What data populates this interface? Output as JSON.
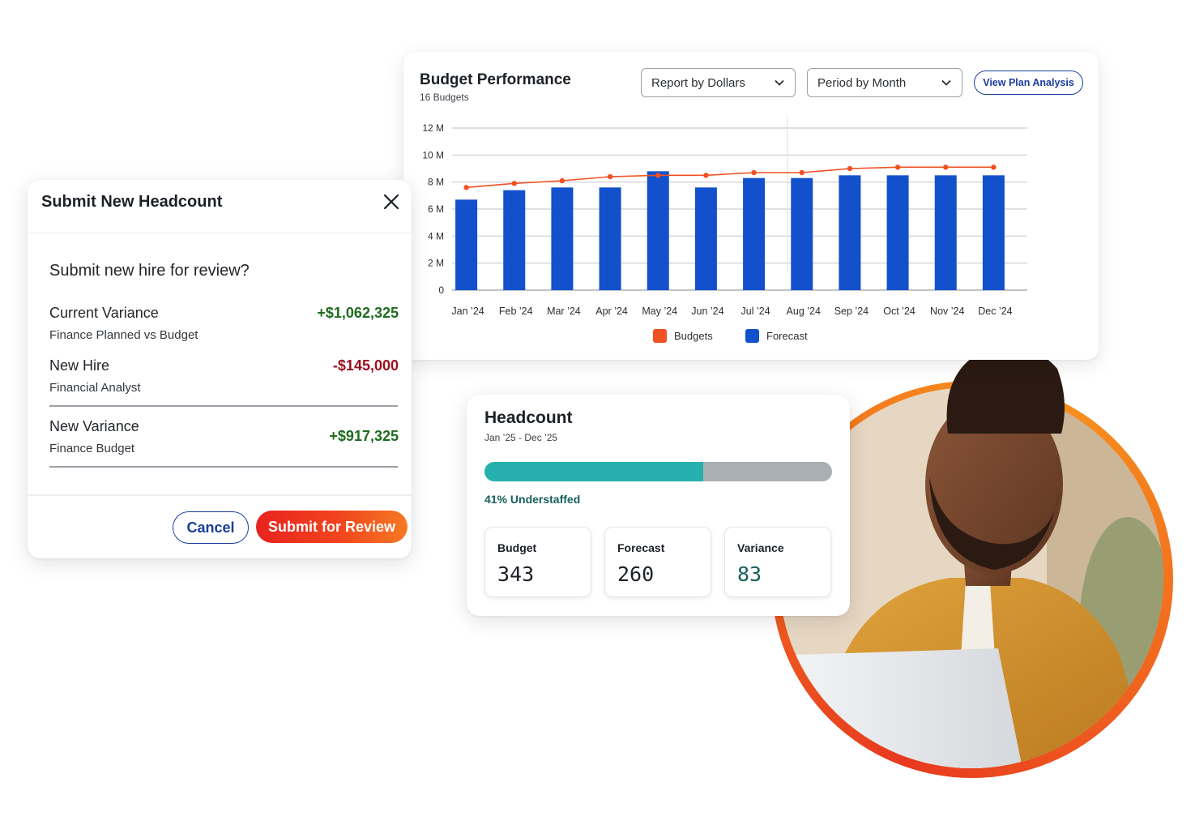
{
  "budget_performance": {
    "title": "Budget Performance",
    "subtitle": "16 Budgets",
    "report_select": "Report by Dollars",
    "period_select": "Period by Month",
    "view_button": "View Plan Analysis",
    "chart_data": {
      "type": "bar",
      "categories": [
        "Jan ’24",
        "Feb ’24",
        "Mar ’24",
        "Apr ’24",
        "May ’24",
        "Jun ’24",
        "Jul ’24",
        "Aug ’24",
        "Sep ’24",
        "Oct ’24",
        "Nov ’24",
        "Dec ’24"
      ],
      "series": [
        {
          "name": "Forecast",
          "type": "bar",
          "color": "#1350cc",
          "values": [
            6.7,
            7.4,
            7.6,
            7.6,
            8.8,
            7.6,
            8.3,
            8.3,
            8.5,
            8.5,
            8.5,
            8.5
          ]
        },
        {
          "name": "Budgets",
          "type": "line",
          "color": "#f05123",
          "values": [
            7.6,
            7.9,
            8.1,
            8.4,
            8.5,
            8.5,
            8.7,
            8.7,
            9.0,
            9.1,
            9.1,
            9.1
          ]
        }
      ],
      "y_ticks": [
        "0",
        "2 M",
        "4 M",
        "6 M",
        "8 M",
        "10 M",
        "12 M"
      ],
      "ylim": [
        0,
        12
      ],
      "grid": true,
      "legend_position": "bottom-center"
    }
  },
  "modal": {
    "title": "Submit New Headcount",
    "question": "Submit new hire for review?",
    "rows": [
      {
        "label": "Current Variance",
        "sub": "Finance Planned vs Budget",
        "value": "+$1,062,325"
      },
      {
        "label": "New Hire",
        "sub": "Financial Analyst",
        "value": "-$145,000"
      },
      {
        "label": "New Variance",
        "sub": "Finance Budget",
        "value": "+$917,325"
      }
    ],
    "cancel_label": "Cancel",
    "submit_label": "Submit for Review"
  },
  "headcount": {
    "title": "Headcount",
    "subtitle": "Jan ’25 - Dec ’25",
    "progress_fraction": 0.63,
    "status": "41% Understaffed",
    "stats": [
      {
        "label": "Budget",
        "value": "343"
      },
      {
        "label": "Forecast",
        "value": "260"
      },
      {
        "label": "Variance",
        "value": "83"
      }
    ]
  },
  "colors": {
    "accent_blue": "#1a3d9e",
    "forecast_blue": "#1350cc",
    "budgets_orange": "#f05123",
    "positive_green": "#1f6b1f",
    "negative_red": "#9b1020",
    "teal": "#25b0ad"
  }
}
